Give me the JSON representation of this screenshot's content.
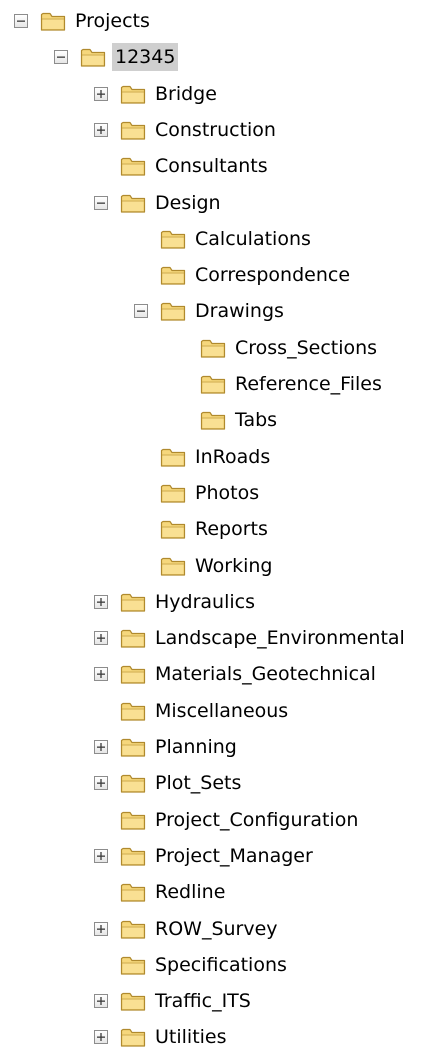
{
  "tree": [
    {
      "label": "Projects",
      "depth": 0,
      "expander": "minus"
    },
    {
      "label": "12345",
      "depth": 1,
      "expander": "minus",
      "selected": true
    },
    {
      "label": "Bridge",
      "depth": 2,
      "expander": "plus"
    },
    {
      "label": "Construction",
      "depth": 2,
      "expander": "plus"
    },
    {
      "label": "Consultants",
      "depth": 2,
      "expander": "none"
    },
    {
      "label": "Design",
      "depth": 2,
      "expander": "minus"
    },
    {
      "label": "Calculations",
      "depth": 3,
      "expander": "none"
    },
    {
      "label": "Correspondence",
      "depth": 3,
      "expander": "none"
    },
    {
      "label": "Drawings",
      "depth": 3,
      "expander": "minus"
    },
    {
      "label": "Cross_Sections",
      "depth": 4,
      "expander": "none"
    },
    {
      "label": "Reference_Files",
      "depth": 4,
      "expander": "none"
    },
    {
      "label": "Tabs",
      "depth": 4,
      "expander": "none"
    },
    {
      "label": "InRoads",
      "depth": 3,
      "expander": "none"
    },
    {
      "label": "Photos",
      "depth": 3,
      "expander": "none"
    },
    {
      "label": "Reports",
      "depth": 3,
      "expander": "none"
    },
    {
      "label": "Working",
      "depth": 3,
      "expander": "none"
    },
    {
      "label": "Hydraulics",
      "depth": 2,
      "expander": "plus"
    },
    {
      "label": "Landscape_Environmental",
      "depth": 2,
      "expander": "plus"
    },
    {
      "label": "Materials_Geotechnical",
      "depth": 2,
      "expander": "plus"
    },
    {
      "label": "Miscellaneous",
      "depth": 2,
      "expander": "none"
    },
    {
      "label": "Planning",
      "depth": 2,
      "expander": "plus"
    },
    {
      "label": "Plot_Sets",
      "depth": 2,
      "expander": "plus"
    },
    {
      "label": "Project_Configuration",
      "depth": 2,
      "expander": "none"
    },
    {
      "label": "Project_Manager",
      "depth": 2,
      "expander": "plus"
    },
    {
      "label": "Redline",
      "depth": 2,
      "expander": "none"
    },
    {
      "label": "ROW_Survey",
      "depth": 2,
      "expander": "plus"
    },
    {
      "label": "Specifications",
      "depth": 2,
      "expander": "none"
    },
    {
      "label": "Traffic_ITS",
      "depth": 2,
      "expander": "plus"
    },
    {
      "label": "Utilities",
      "depth": 2,
      "expander": "plus"
    }
  ],
  "colors": {
    "folder_fill": "#f6d77c",
    "folder_stroke": "#b08a2e",
    "selection_bg": "#cfcfcf",
    "toggle_border": "#8c8c8c"
  },
  "icons": {
    "folder": "folder-icon",
    "expand": "plus-box-icon",
    "collapse": "minus-box-icon"
  }
}
